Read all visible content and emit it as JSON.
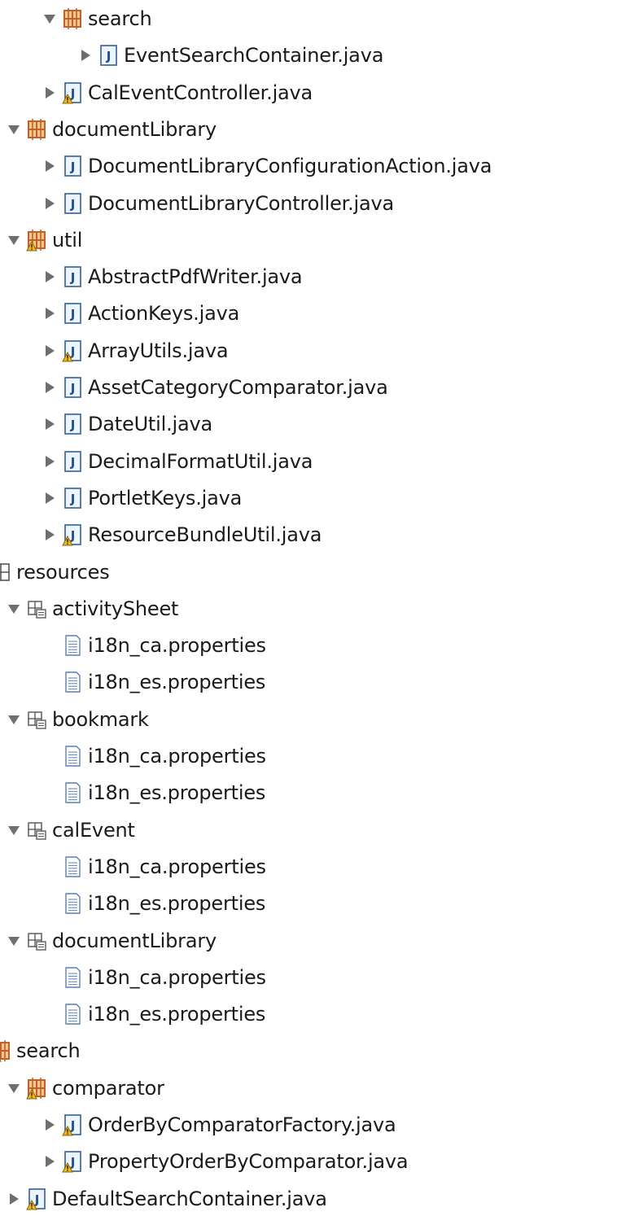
{
  "colors": {
    "package": "#c0602a",
    "package_fill": "#f3c78c",
    "java_border": "#2f5f9a",
    "java_fill": "#eef4fb",
    "java_letter": "#1f4f8f",
    "warning": "#f2b81b",
    "arrow": "#6e6e6e",
    "folder_stroke": "#5a5a5a",
    "file_stroke": "#5a7fb0"
  },
  "tree": [
    {
      "label": "search",
      "depth": 1,
      "toggle": "expanded",
      "icon": "package-icon",
      "warning": false
    },
    {
      "label": "EventSearchContainer.java",
      "depth": 2,
      "toggle": "collapsed",
      "icon": "java-file-icon",
      "warning": false
    },
    {
      "label": "CalEventController.java",
      "depth": 1,
      "toggle": "collapsed",
      "icon": "java-file-icon",
      "warning": true
    },
    {
      "label": "documentLibrary",
      "depth": 0,
      "toggle": "expanded",
      "icon": "package-icon",
      "warning": false
    },
    {
      "label": "DocumentLibraryConfigurationAction.java",
      "depth": 1,
      "toggle": "collapsed",
      "icon": "java-file-icon",
      "warning": false
    },
    {
      "label": "DocumentLibraryController.java",
      "depth": 1,
      "toggle": "collapsed",
      "icon": "java-file-icon",
      "warning": false
    },
    {
      "label": "util",
      "depth": 0,
      "toggle": "expanded",
      "icon": "package-icon",
      "warning": true
    },
    {
      "label": "AbstractPdfWriter.java",
      "depth": 1,
      "toggle": "collapsed",
      "icon": "java-file-icon",
      "warning": false
    },
    {
      "label": "ActionKeys.java",
      "depth": 1,
      "toggle": "collapsed",
      "icon": "java-file-icon",
      "warning": false
    },
    {
      "label": "ArrayUtils.java",
      "depth": 1,
      "toggle": "collapsed",
      "icon": "java-file-icon",
      "warning": true
    },
    {
      "label": "AssetCategoryComparator.java",
      "depth": 1,
      "toggle": "collapsed",
      "icon": "java-file-icon",
      "warning": false
    },
    {
      "label": "DateUtil.java",
      "depth": 1,
      "toggle": "collapsed",
      "icon": "java-file-icon",
      "warning": false
    },
    {
      "label": "DecimalFormatUtil.java",
      "depth": 1,
      "toggle": "collapsed",
      "icon": "java-file-icon",
      "warning": false
    },
    {
      "label": "PortletKeys.java",
      "depth": 1,
      "toggle": "collapsed",
      "icon": "java-file-icon",
      "warning": false
    },
    {
      "label": "ResourceBundleUtil.java",
      "depth": 1,
      "toggle": "collapsed",
      "icon": "java-file-icon",
      "warning": true
    },
    {
      "label": "resources",
      "depth": -1,
      "toggle": "expanded",
      "icon": "empty-package-icon",
      "warning": false
    },
    {
      "label": "activitySheet",
      "depth": 0,
      "toggle": "expanded",
      "icon": "resource-folder-icon",
      "warning": false
    },
    {
      "label": "i18n_ca.properties",
      "depth": 1,
      "toggle": "none",
      "icon": "properties-file-icon",
      "warning": false
    },
    {
      "label": "i18n_es.properties",
      "depth": 1,
      "toggle": "none",
      "icon": "properties-file-icon",
      "warning": false
    },
    {
      "label": "bookmark",
      "depth": 0,
      "toggle": "expanded",
      "icon": "resource-folder-icon",
      "warning": false
    },
    {
      "label": "i18n_ca.properties",
      "depth": 1,
      "toggle": "none",
      "icon": "properties-file-icon",
      "warning": false
    },
    {
      "label": "i18n_es.properties",
      "depth": 1,
      "toggle": "none",
      "icon": "properties-file-icon",
      "warning": false
    },
    {
      "label": "calEvent",
      "depth": 0,
      "toggle": "expanded",
      "icon": "resource-folder-icon",
      "warning": false
    },
    {
      "label": "i18n_ca.properties",
      "depth": 1,
      "toggle": "none",
      "icon": "properties-file-icon",
      "warning": false
    },
    {
      "label": "i18n_es.properties",
      "depth": 1,
      "toggle": "none",
      "icon": "properties-file-icon",
      "warning": false
    },
    {
      "label": "documentLibrary",
      "depth": 0,
      "toggle": "expanded",
      "icon": "resource-folder-icon",
      "warning": false
    },
    {
      "label": "i18n_ca.properties",
      "depth": 1,
      "toggle": "none",
      "icon": "properties-file-icon",
      "warning": false
    },
    {
      "label": "i18n_es.properties",
      "depth": 1,
      "toggle": "none",
      "icon": "properties-file-icon",
      "warning": false
    },
    {
      "label": "search",
      "depth": -1,
      "toggle": "expanded",
      "icon": "package-icon",
      "warning": true
    },
    {
      "label": "comparator",
      "depth": 0,
      "toggle": "expanded",
      "icon": "package-icon",
      "warning": true
    },
    {
      "label": "OrderByComparatorFactory.java",
      "depth": 1,
      "toggle": "collapsed",
      "icon": "java-file-icon",
      "warning": true
    },
    {
      "label": "PropertyOrderByComparator.java",
      "depth": 1,
      "toggle": "collapsed",
      "icon": "java-file-icon",
      "warning": true
    },
    {
      "label": "DefaultSearchContainer.java",
      "depth": 0,
      "toggle": "collapsed",
      "icon": "java-file-icon",
      "warning": true
    }
  ]
}
